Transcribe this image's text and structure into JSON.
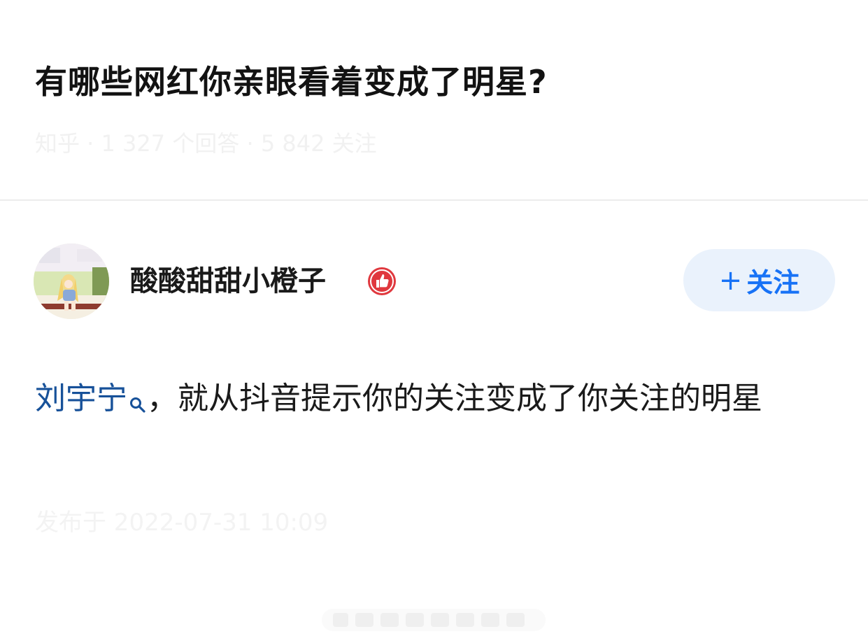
{
  "question": {
    "title": "有哪些网红你亲眼看着变成了明星?",
    "meta": "知乎 · 1 327 个回答 · 5 842 关注"
  },
  "author": {
    "name": "酸酸甜甜小橙子",
    "badge_icon": "thumbs-up-badge-icon",
    "follow_label": "关注",
    "follow_plus": "+"
  },
  "answer": {
    "link_text": "刘宇宁",
    "link_icon": "search-icon",
    "body_text": "，就从抖音提示你的关注变成了你关注的明星",
    "time": "发布于 2022-07-31 10:09"
  },
  "colors": {
    "link": "#175199",
    "accent": "#1772f6",
    "follow_bg": "#eaf2fc",
    "badge": "#e0383e"
  }
}
